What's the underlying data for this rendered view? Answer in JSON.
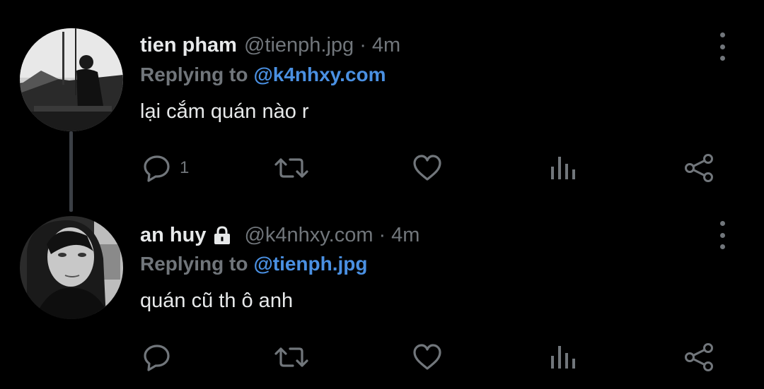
{
  "colors": {
    "background": "#000000",
    "text": "#e7e9ea",
    "muted": "#71767b",
    "link": "#4a90e2",
    "thread_line": "#3b3f45"
  },
  "tweets": [
    {
      "name": "tien pham",
      "handle": "@tienph.jpg",
      "separator": "·",
      "time": "4m",
      "replying_prefix": "Replying to",
      "replying_to": "@k4nhxy.com",
      "text": "lại cắm quán nào r",
      "reply_count": "1",
      "locked": false,
      "icons": [
        "reply-icon",
        "retweet-icon",
        "like-icon",
        "views-icon",
        "share-icon",
        "more-icon"
      ]
    },
    {
      "name": "an huy",
      "handle": "@k4nhxy.com",
      "separator": "·",
      "time": "4m",
      "replying_prefix": "Replying to",
      "replying_to": "@tienph.jpg",
      "text": "quán cũ th ô anh",
      "reply_count": "",
      "locked": true,
      "icons": [
        "reply-icon",
        "retweet-icon",
        "like-icon",
        "views-icon",
        "share-icon",
        "more-icon"
      ]
    }
  ]
}
